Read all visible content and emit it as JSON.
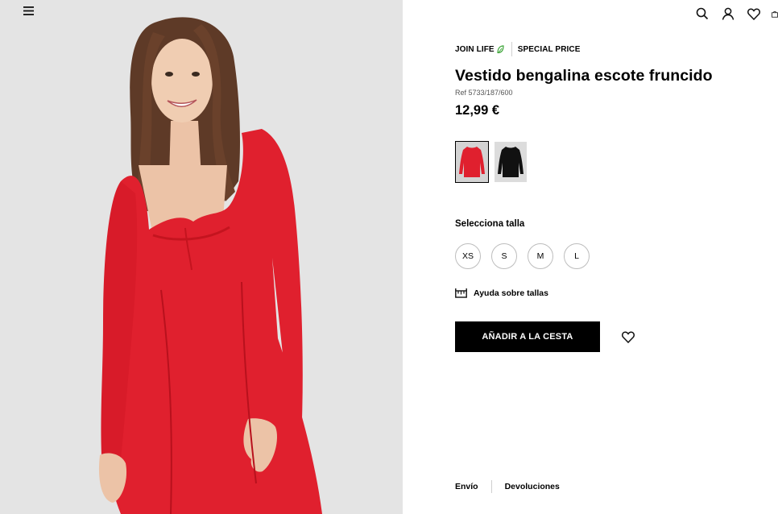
{
  "header": {
    "icons": [
      "menu-icon",
      "search-icon",
      "user-icon",
      "heart-icon",
      "bag-icon"
    ]
  },
  "product": {
    "badges": {
      "join_life": "JOIN LIFE",
      "special_price": "SPECIAL PRICE"
    },
    "title": "Vestido bengalina escote fruncido",
    "ref": "Ref 5733/187/600",
    "price": "12,99 €",
    "colors": [
      {
        "name": "red",
        "hex": "#e0202e",
        "selected": true
      },
      {
        "name": "black",
        "hex": "#111111",
        "selected": false
      }
    ],
    "size_label": "Selecciona talla",
    "sizes": [
      "XS",
      "S",
      "M",
      "L"
    ],
    "size_help": "Ayuda sobre tallas",
    "add_to_cart": "AÑADIR A LA CESTA"
  },
  "footer": {
    "shipping": "Envío",
    "returns": "Devoluciones"
  },
  "colors": {
    "accent_leaf": "#3aa335",
    "dress_red": "#e0202e",
    "background_image": "#e4e4e4"
  }
}
